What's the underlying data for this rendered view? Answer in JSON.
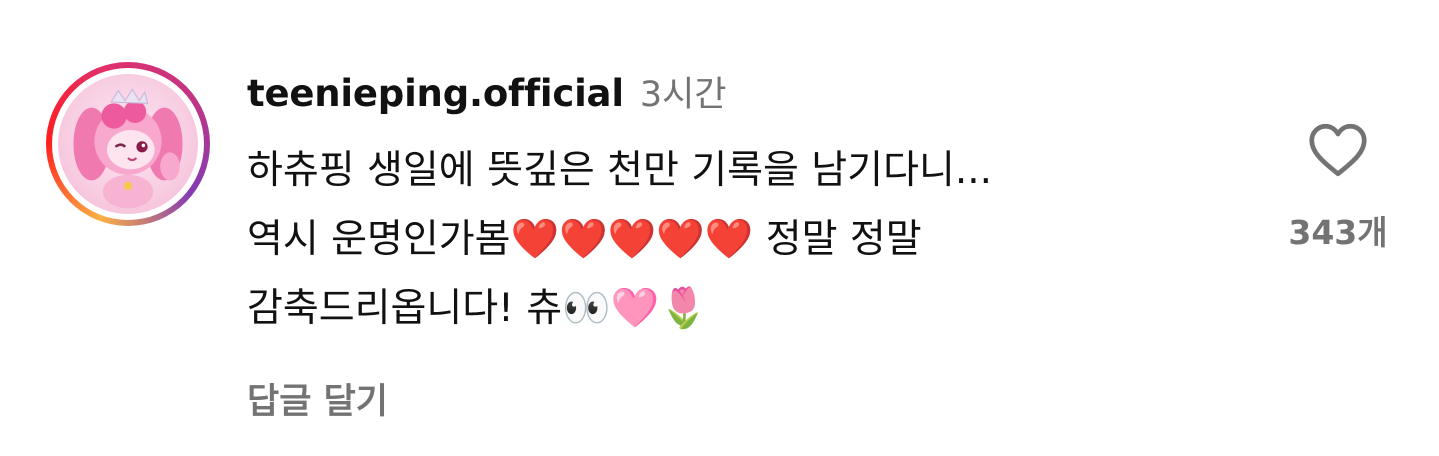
{
  "comment": {
    "username": "teenieping.official",
    "timestamp": "3시간",
    "text": "하츄핑 생일에 뜻깊은 천만 기록을 남기다니...\n역시 운명인가봄❤️❤️❤️❤️❤️ 정말 정말\n감축드리옵니다! 츄👀🩷🌷",
    "reply_label": "답글 달기",
    "like_count": "343개",
    "like_icon": "heart-outline-icon",
    "avatar_icon": "pink-character-avatar"
  },
  "colors": {
    "primary_text": "#111111",
    "secondary_text": "#737373",
    "story_ring": [
      "#fcb045",
      "#fd1d1d",
      "#e1306c",
      "#c13584",
      "#833ab4"
    ]
  }
}
